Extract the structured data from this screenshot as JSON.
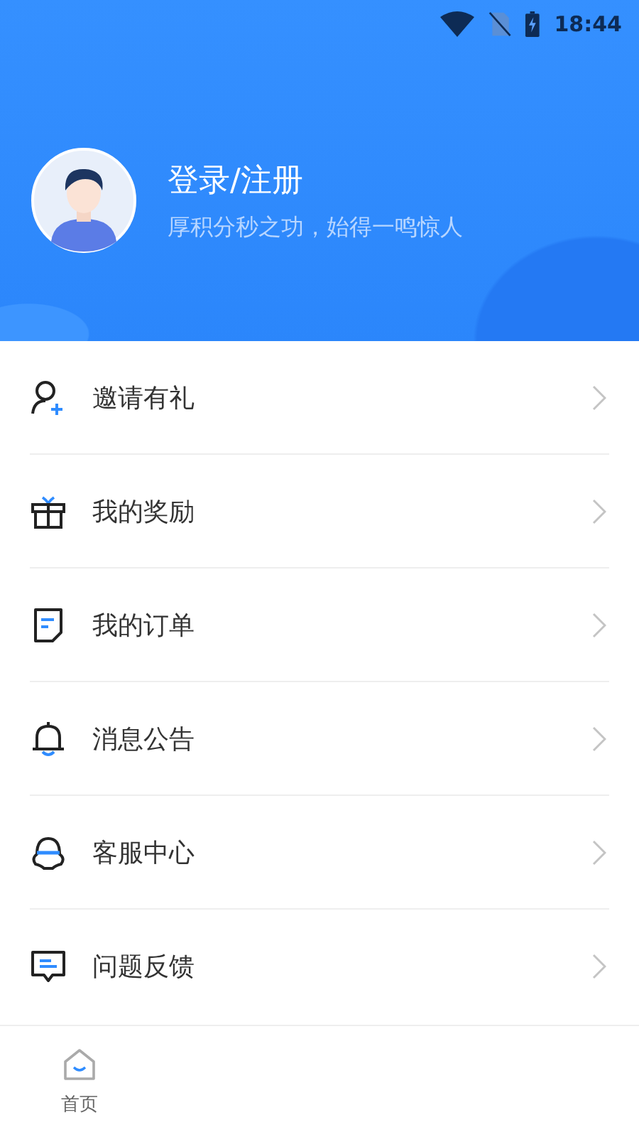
{
  "status_bar": {
    "time": "18:44"
  },
  "profile": {
    "title": "登录/注册",
    "subtitle": "厚积分秒之功，始得一鸣惊人"
  },
  "menu": [
    {
      "kind": "invite",
      "label": "邀请有礼"
    },
    {
      "kind": "gift",
      "label": "我的奖励"
    },
    {
      "kind": "order",
      "label": "我的订单"
    },
    {
      "kind": "bell",
      "label": "消息公告"
    },
    {
      "kind": "service",
      "label": "客服中心"
    },
    {
      "kind": "feedback",
      "label": "问题反馈"
    }
  ],
  "tabs": [
    {
      "label": "首页",
      "selected": false
    }
  ]
}
